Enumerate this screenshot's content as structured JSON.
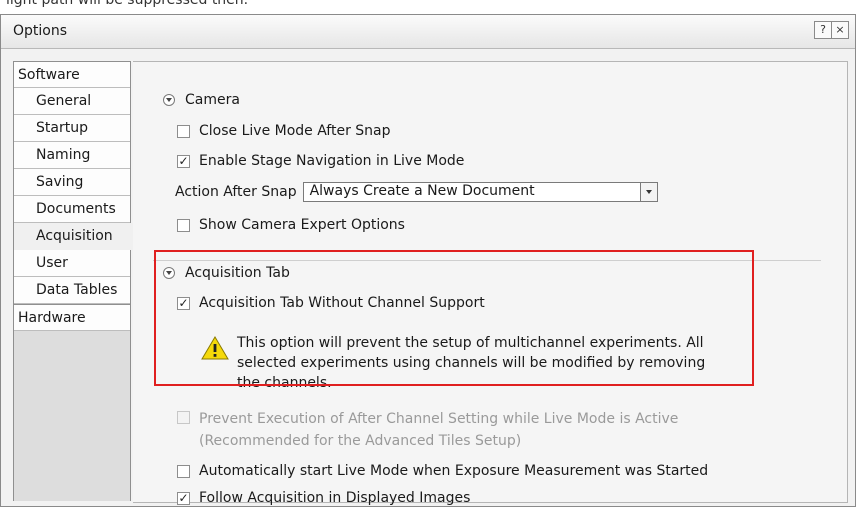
{
  "intro_text": "light path will be suppressed then.",
  "window": {
    "title": "Options",
    "help_button": "?",
    "close_button": "×"
  },
  "sidebar": {
    "items": [
      {
        "label": "Software",
        "type": "category"
      },
      {
        "label": "General"
      },
      {
        "label": "Startup"
      },
      {
        "label": "Naming"
      },
      {
        "label": "Saving"
      },
      {
        "label": "Documents"
      },
      {
        "label": "Acquisition",
        "selected": true
      },
      {
        "label": "User"
      },
      {
        "label": "Data Tables"
      },
      {
        "label": "Hardware",
        "type": "category"
      }
    ]
  },
  "camera": {
    "header": "Camera",
    "close_live_mode": {
      "label": "Close Live Mode After Snap",
      "checked": false
    },
    "enable_stage_nav": {
      "label": "Enable Stage Navigation in Live Mode",
      "checked": true
    },
    "action_after_snap_label": "Action After Snap",
    "action_after_snap_value": "Always Create a New Document",
    "show_expert": {
      "label": "Show Camera Expert Options",
      "checked": false
    }
  },
  "acquisition_tab": {
    "header": "Acquisition Tab",
    "without_channel": {
      "label": "Acquisition Tab Without Channel Support",
      "checked": true
    },
    "warning_lines": [
      "This option will prevent the setup of multichannel experiments. All",
      "selected experiments using channels will be modified by removing",
      "the channels."
    ],
    "prevent_exec_lines": [
      "Prevent Execution of After Channel Setting while Live Mode is Active",
      "(Recommended for the Advanced Tiles Setup)"
    ],
    "auto_live": {
      "label": "Automatically start Live Mode when Exposure Measurement was Started",
      "checked": false
    },
    "follow_acq": {
      "label": "Follow Acquisition in Displayed Images",
      "checked": true
    }
  },
  "colors": {
    "highlight_border": "#e02020",
    "warning_fill": "#f5d90a"
  }
}
